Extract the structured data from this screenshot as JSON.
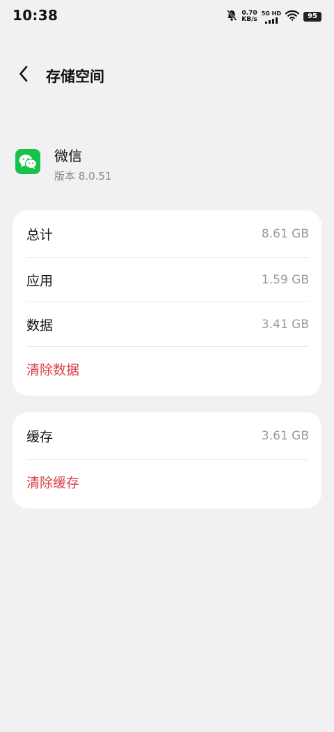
{
  "status_bar": {
    "time": "10:38",
    "net_speed_value": "0.70",
    "net_speed_unit": "KB/s",
    "network_type": "5G HD",
    "battery": "95"
  },
  "header": {
    "title": "存储空间"
  },
  "app": {
    "name": "微信",
    "version": "版本 8.0.51",
    "icon": "wechat-icon",
    "icon_color": "#17c24b"
  },
  "storage": {
    "total_label": "总计",
    "total_value": "8.61 GB",
    "app_label": "应用",
    "app_value": "1.59 GB",
    "data_label": "数据",
    "data_value": "3.41 GB",
    "clear_data_label": "清除数据"
  },
  "cache": {
    "cache_label": "缓存",
    "cache_value": "3.61 GB",
    "clear_cache_label": "清除缓存"
  },
  "colors": {
    "background": "#f1f1f3",
    "card": "#ffffff",
    "action": "#d8404a",
    "secondary_text": "#9a9a9a"
  }
}
